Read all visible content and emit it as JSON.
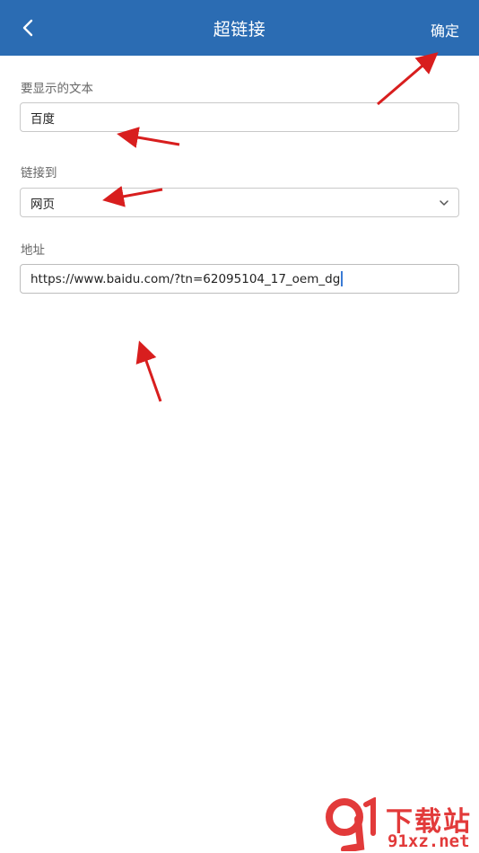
{
  "header": {
    "title": "超链接",
    "confirm_label": "确定"
  },
  "form": {
    "display_text": {
      "label": "要显示的文本",
      "value": "百度"
    },
    "link_to": {
      "label": "链接到",
      "selected": "网页"
    },
    "address": {
      "label": "地址",
      "value": "https://www.baidu.com/?tn=62095104_17_oem_dg"
    }
  },
  "watermark": {
    "logo_text": "9",
    "site_name": "下载站",
    "url": "91xz.net"
  },
  "colors": {
    "appbar": "#2b6cb3",
    "annotation_arrow": "#d81e1e",
    "watermark": "#e23a3a"
  }
}
